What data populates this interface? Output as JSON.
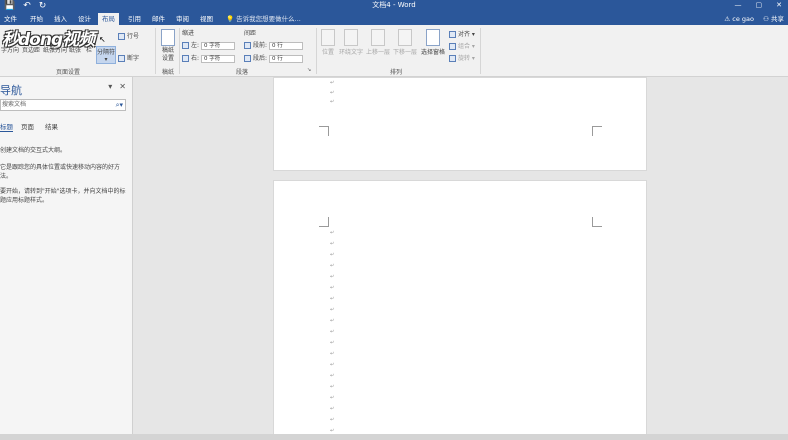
{
  "window": {
    "title": "文档4 - Word",
    "minimize": "—",
    "restore": "▢",
    "close": "✕"
  },
  "qat": {
    "save": "💾",
    "undo": "↶",
    "redo": "↻"
  },
  "tabs": [
    "文件",
    "开始",
    "插入",
    "设计",
    "布局",
    "引用",
    "邮件",
    "审阅",
    "视图"
  ],
  "active_tab": "布局",
  "tell_me": "告诉我您想要做什么...",
  "user": "ce gao",
  "share": "共享",
  "ribbon": {
    "page_setup": {
      "buttons": [
        "字方向",
        "页边距",
        "纸张方向",
        "纸张",
        "栏",
        "分隔符"
      ],
      "line_numbers": "行号",
      "hyphenation": "断字",
      "group_label": "页面设置"
    },
    "manuscript": {
      "button": "稿纸设置",
      "group_label": "稿纸"
    },
    "paragraph": {
      "indent_label": "缩进",
      "spacing_label": "间距",
      "left_label": "左:",
      "left_value": "0 字符",
      "right_label": "右:",
      "right_value": "0 字符",
      "before_label": "段前:",
      "before_value": "0 行",
      "after_label": "段后:",
      "after_value": "0 行",
      "group_label": "段落"
    },
    "arrange": {
      "buttons": [
        "位置",
        "环绕文字",
        "上移一层",
        "下移一层",
        "选择窗格"
      ],
      "align": "对齐",
      "group": "组合",
      "rotate": "旋转",
      "group_label": "排列"
    }
  },
  "watermark": "秒dong视频",
  "nav": {
    "title": "导航",
    "search_placeholder": "搜索文档",
    "tabs": [
      "标题",
      "页面",
      "结果"
    ],
    "paragraphs": [
      "创建文档的交互式大纲。",
      "它是跟踪您的具体位置或快速移动内容的好方法。",
      "要开始，请转到\"开始\"选项卡，并向文档中的标题应用标题样式。"
    ]
  },
  "doc": {
    "paragraph_mark": "↵"
  }
}
